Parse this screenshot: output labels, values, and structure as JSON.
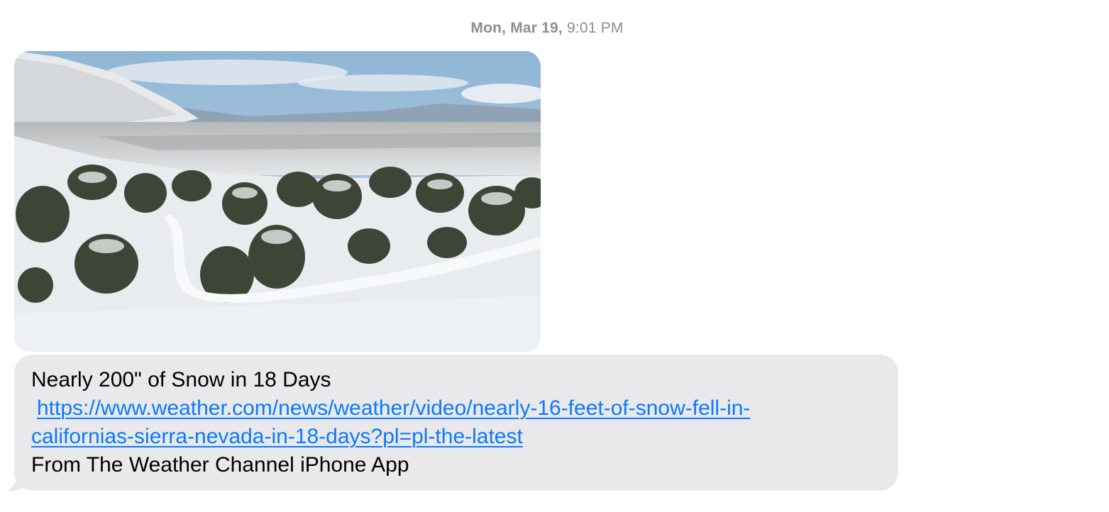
{
  "timestamp": {
    "day": "Mon, Mar 19,",
    "time": "9:01 PM"
  },
  "image": {
    "icon": "snowy-landscape-photo"
  },
  "message": {
    "title": "Nearly 200\" of Snow in 18 Days",
    "link_line1": "https://www.weather.com/news/weather/video/nearly-16-feet-of-snow-fell-in-",
    "link_line2": "californias-sierra-nevada-in-18-days?pl=pl-the-latest",
    "source": "From The Weather Channel iPhone App"
  },
  "colors": {
    "bubble_gray": "#e9e9eb",
    "link_blue": "#0a7aff",
    "timestamp_gray": "#8e8e93"
  }
}
